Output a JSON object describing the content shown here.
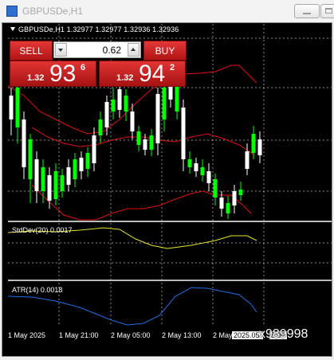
{
  "window": {
    "title": "GBPUSDe,H1"
  },
  "chart": {
    "symbol_line": "GBPUSDe,H1  1.32977 1.32977 1.32936 1.32936",
    "colors": {
      "background": "#000000",
      "bull": "#00ff00",
      "bear": "#ffffff",
      "ma": "#e01010",
      "grid": "#ffffff",
      "stddev": "#e6e62a",
      "atr": "#1e6ee8"
    }
  },
  "trade_panel": {
    "sell_label": "SELL",
    "buy_label": "BUY",
    "lot_value": "0.62",
    "sell_price": {
      "prefix": "1.32",
      "main": "93",
      "sup": "6"
    },
    "buy_price": {
      "prefix": "1.32",
      "main": "94",
      "sup": "2"
    }
  },
  "indicators": {
    "stddev_label": "StdDev(20) 0.0017",
    "atr_label": "ATR(14) 0.0018"
  },
  "time_axis": {
    "labels": [
      "1 May 2025",
      "1 May 21:00",
      "2 May 05:00",
      "2 May 13:00",
      "2 May",
      "2025.05.",
      "5:00"
    ]
  },
  "watermark": "x989998"
}
